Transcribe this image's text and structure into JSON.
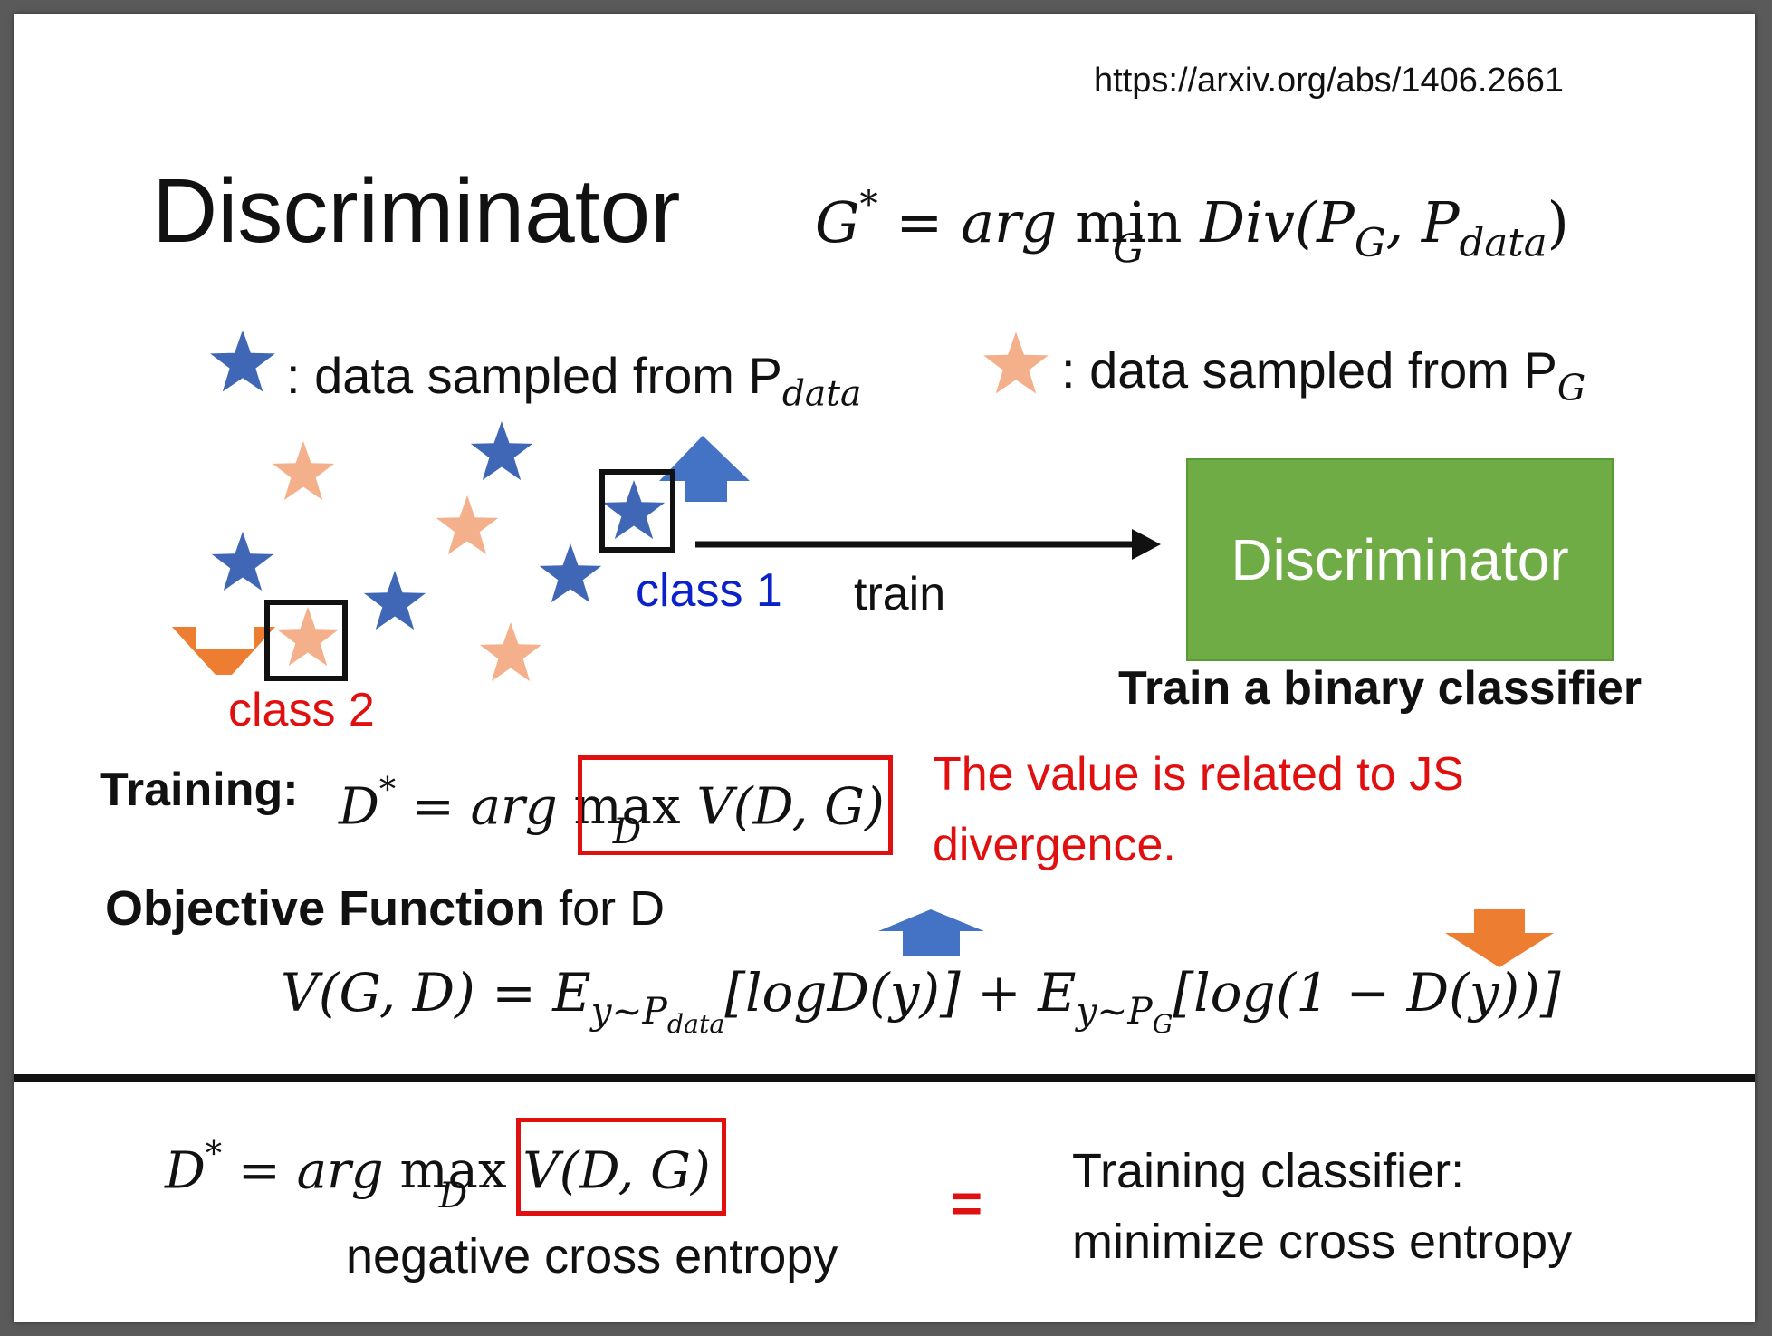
{
  "slide": {
    "url": "https://arxiv.org/abs/1406.2661",
    "title": "Discriminator",
    "top_equation": {
      "lhs": "G",
      "star": "*",
      "eq": " = ",
      "arg": "arg ",
      "op": "min",
      "op_sub": "G",
      "rest": " Div(P",
      "sub1": "G",
      "comma": ", P",
      "sub2": "data",
      "close": ")"
    },
    "legend": {
      "blue_text": ": data sampled from P",
      "blue_sub": "data",
      "orange_text": ": data sampled from P",
      "orange_sub": "G"
    },
    "diagram": {
      "class1": "class 1",
      "class2": "class 2",
      "train": "train",
      "discriminator_box": "Discriminator",
      "binary_caption": "Train a binary classifier"
    },
    "training": {
      "label": "Training:",
      "lhs": "D",
      "star": "*",
      "eq": " = ",
      "arg": "arg ",
      "op": "max",
      "op_sub": "D",
      "rest": " V(D, G)",
      "note": "The value is related to JS divergence."
    },
    "objective": {
      "bold": "Objective Function",
      "rest": " for D",
      "equation": {
        "lhs": "V(G, D) = E",
        "sub1": "y~P",
        "sub1b": "data",
        "part1": "[logD(y)] + E",
        "sub2": "y~P",
        "sub2b": "G",
        "part2": "[log(1 − D(y))]"
      }
    },
    "bottom": {
      "lhs": "D",
      "star": "*",
      "eq": " = ",
      "arg": "arg ",
      "op": "max",
      "op_sub": "D",
      "rest": " V(D, G)",
      "caption": "negative cross entropy",
      "equals": "=",
      "right_line1": "Training classifier:",
      "right_line2": "minimize cross entropy"
    },
    "colors": {
      "blue_star": "#3f67b5",
      "orange_star": "#f4b08a",
      "blue_arrow": "#4472c4",
      "orange_arrow": "#ed7d31",
      "box_green": "#6fac46",
      "accent_red": "#e01010",
      "class1_blue": "#0a22c8"
    },
    "icons": [
      "blue-star-icon",
      "orange-star-icon",
      "up-arrow-icon",
      "down-arrow-icon",
      "right-arrow-icon"
    ]
  }
}
